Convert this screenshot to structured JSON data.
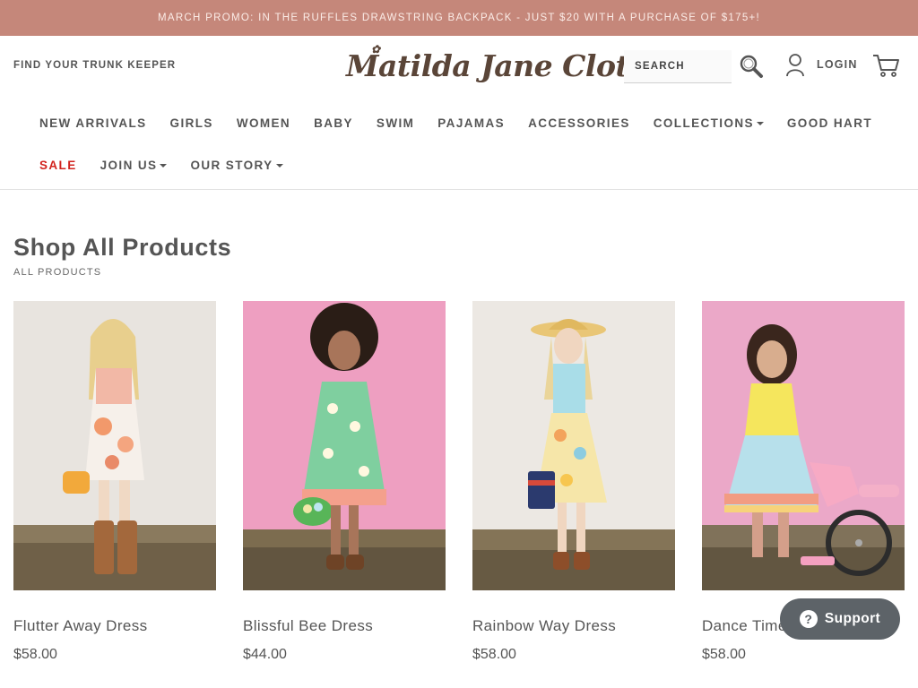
{
  "promo": {
    "text": "MARCH PROMO: IN THE RUFFLES DRAWSTRING BACKPACK - JUST $20 WITH A PURCHASE OF $175+!"
  },
  "header": {
    "trunk_link": "FIND YOUR TRUNK KEEPER",
    "logo_text": "Matilda Jane Clothing",
    "search_placeholder": "SEARCH",
    "login_label": "LOGIN"
  },
  "nav": {
    "row1": [
      "NEW ARRIVALS",
      "GIRLS",
      "WOMEN",
      "BABY",
      "SWIM",
      "PAJAMAS",
      "ACCESSORIES",
      "COLLECTIONS",
      "GOOD HART"
    ],
    "row2": [
      "SALE",
      "JOIN US",
      "OUR STORY"
    ]
  },
  "page": {
    "title": "Shop All Products",
    "breadcrumb": "ALL PRODUCTS"
  },
  "products": [
    {
      "name": "Flutter Away Dress",
      "price": "$58.00"
    },
    {
      "name": "Blissful Bee Dress",
      "price": "$44.00"
    },
    {
      "name": "Rainbow Way Dress",
      "price": "$58.00"
    },
    {
      "name": "Dance Time Dress",
      "price": "$58.00"
    }
  ],
  "support": {
    "label": "Support"
  },
  "colors": {
    "promo_bg": "#c5877a",
    "sale": "#d2231e",
    "support_bg": "#5d6368"
  }
}
